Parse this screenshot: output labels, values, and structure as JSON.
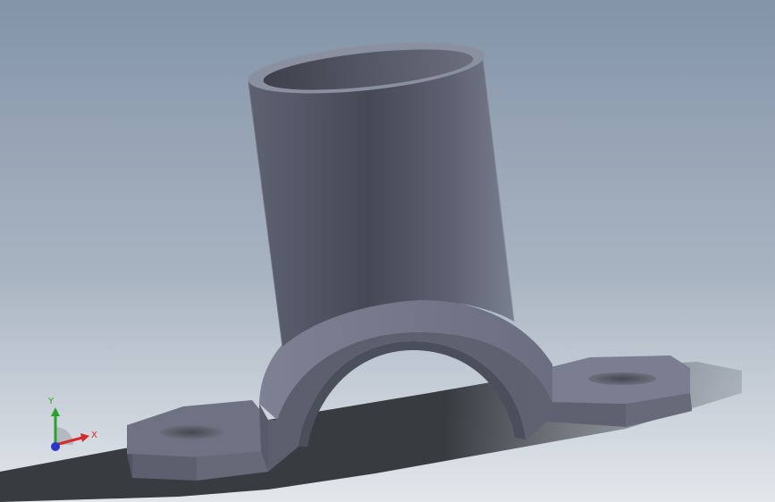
{
  "viewport": {
    "background_top": "#8797aa",
    "background_bottom": "#dfe4ea",
    "model_color": "#5d6170",
    "model_dark": "#3c3f4a",
    "model_light": "#8c91a3",
    "shadow_color": "#2e3034"
  },
  "triad": {
    "x_label": "X",
    "y_label": "Y",
    "x_color": "#d42a2a",
    "y_color": "#2aa22a",
    "z_color": "#2a36c8"
  }
}
